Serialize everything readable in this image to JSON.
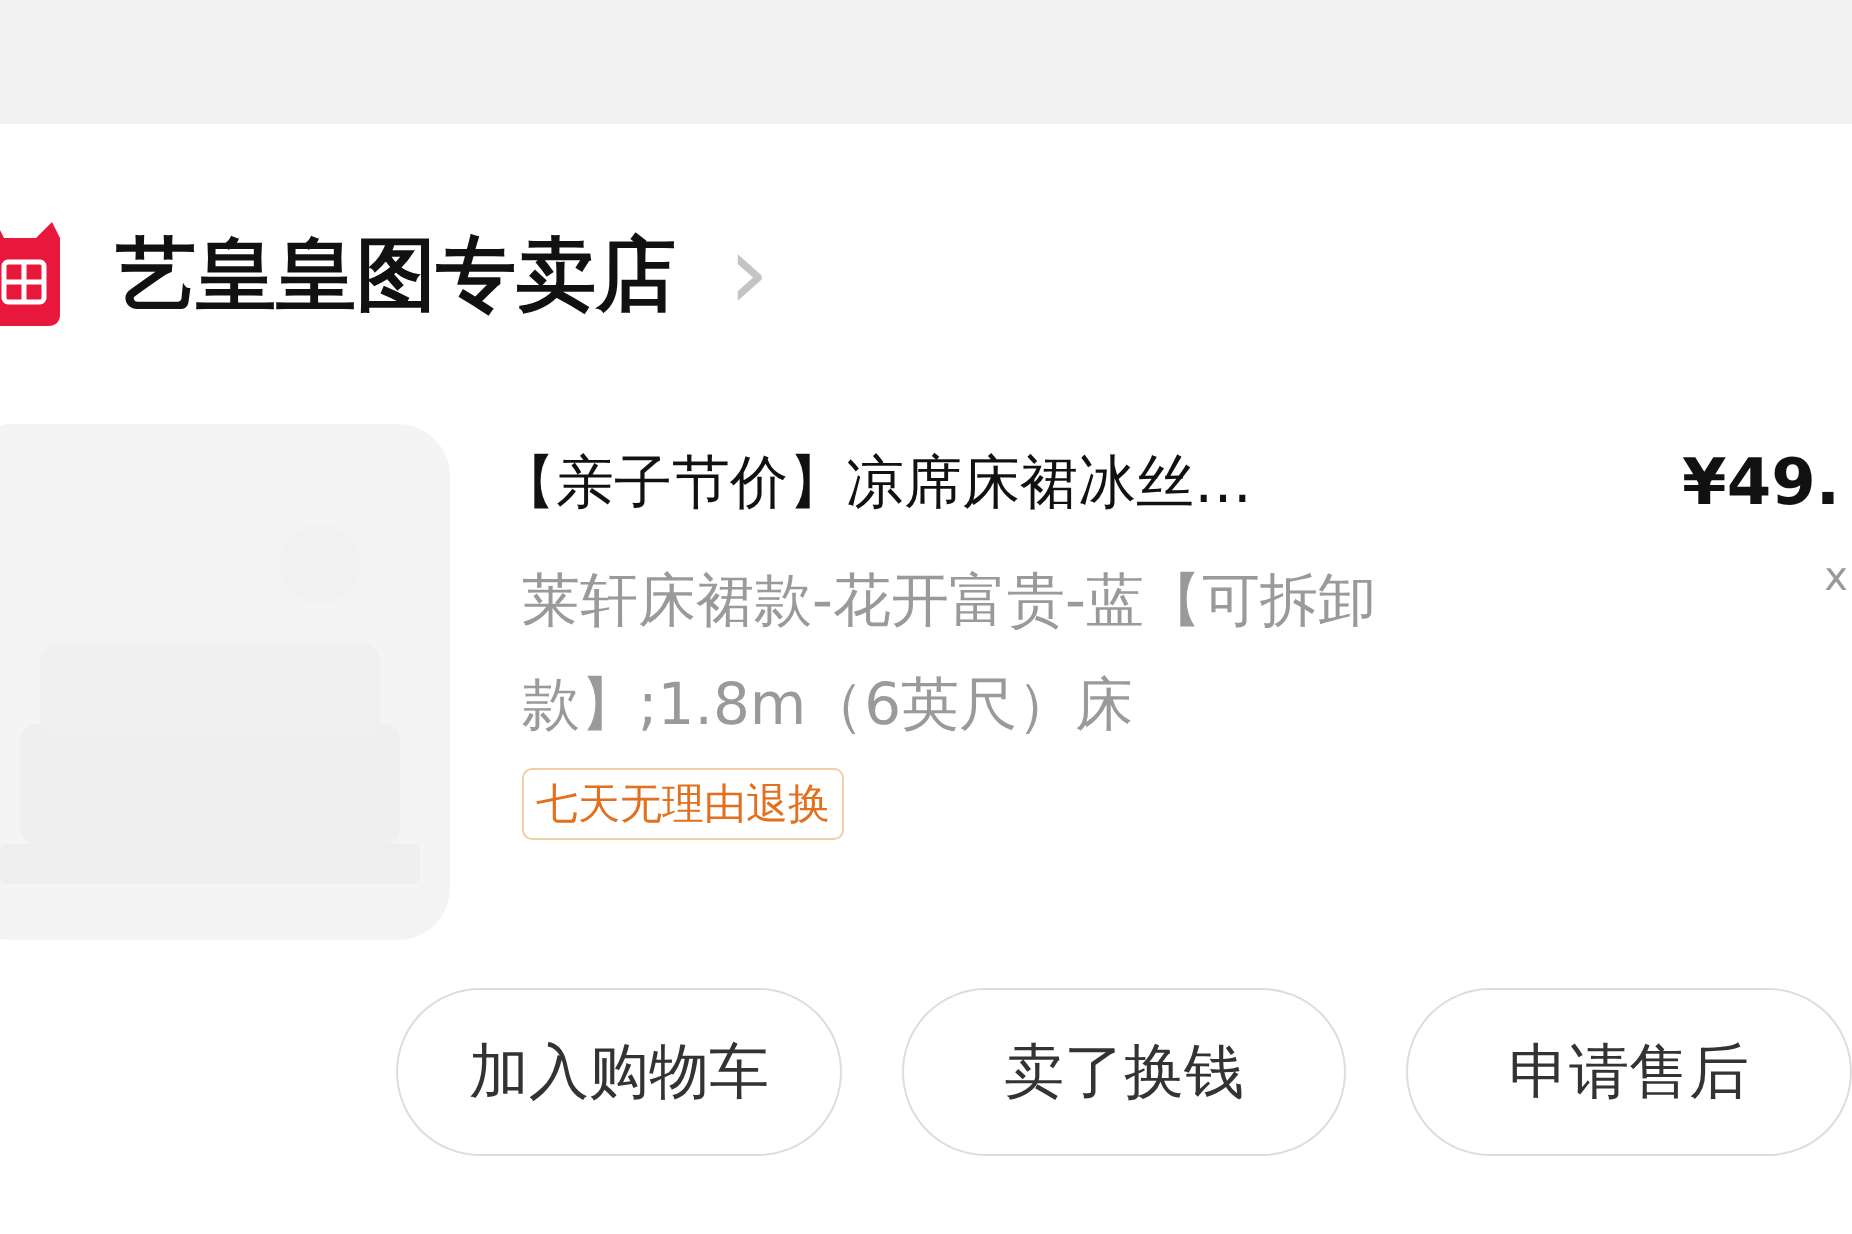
{
  "store": {
    "name": "艺皇皇图专卖店",
    "arrow": "›"
  },
  "item": {
    "title": "【亲子节价】凉席床裙冰丝…",
    "price": "¥49.",
    "spec": "莱轩床裙款-花开富贵-蓝【可拆卸款】;1.8m（6英尺）床",
    "quantity": "x",
    "tag": "七天无理由退换"
  },
  "buttons": [
    "加入购物车",
    "卖了换钱",
    "申请售后"
  ]
}
